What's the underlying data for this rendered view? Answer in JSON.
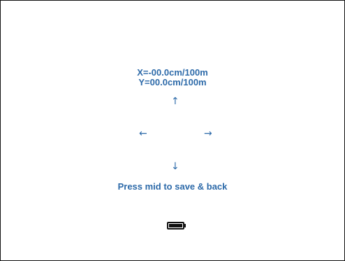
{
  "readout": {
    "x": "X=-00.0cm/100m",
    "y": "Y=00.0cm/100m"
  },
  "arrows": {
    "up": "↑",
    "left": "←",
    "right": "→",
    "down": "↓"
  },
  "hint": "Press mid to save & back",
  "battery": {
    "icon": "battery-icon",
    "level": 1.0
  },
  "colors": {
    "accent": "#2d6aa9",
    "frame": "#111111",
    "background": "#ffffff"
  }
}
